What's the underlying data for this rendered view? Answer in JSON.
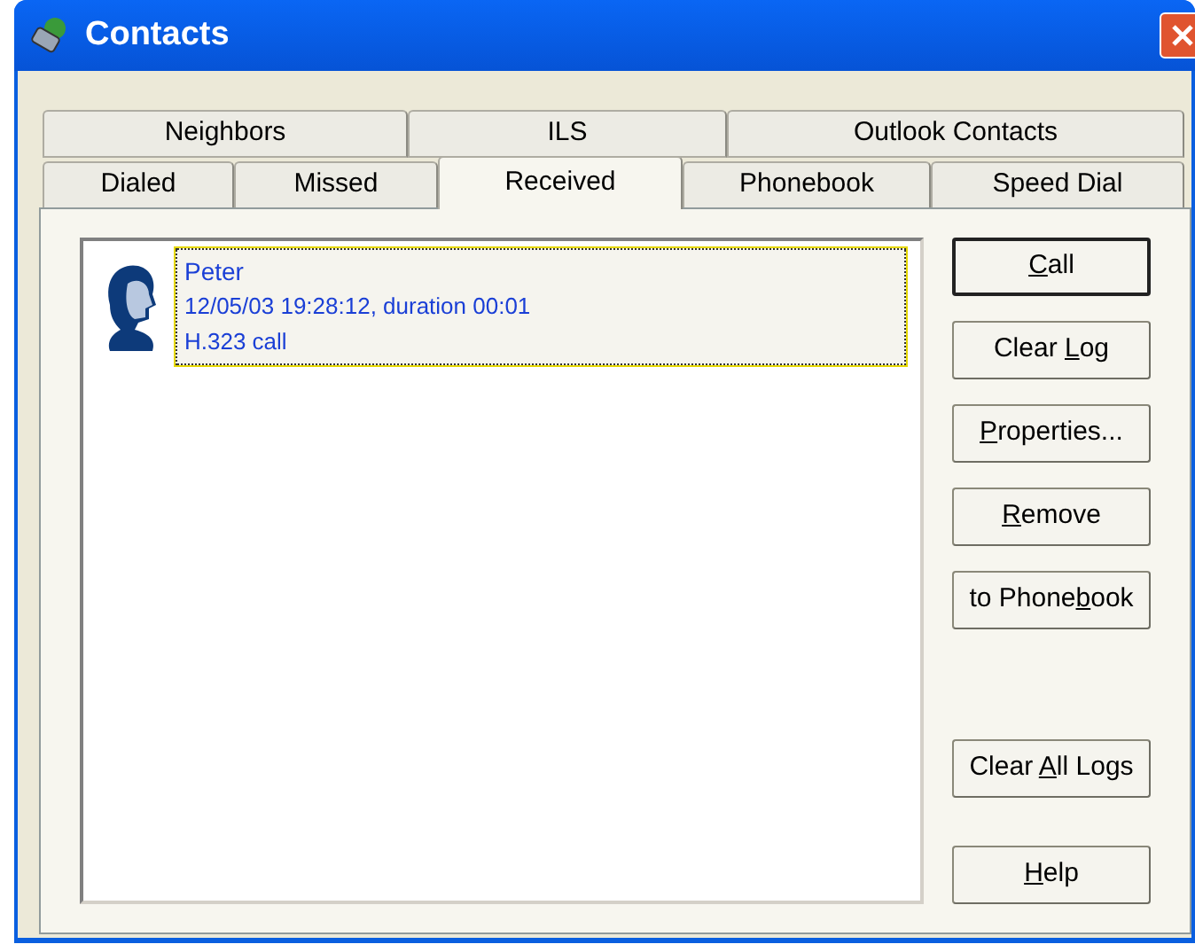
{
  "window": {
    "title": "Contacts"
  },
  "tab_rows": [
    [
      {
        "label": "Neighbors",
        "selected": false
      },
      {
        "label": "ILS",
        "selected": false
      },
      {
        "label": "Outlook Contacts",
        "selected": false
      }
    ],
    [
      {
        "label": "Dialed",
        "selected": false
      },
      {
        "label": "Missed",
        "selected": false
      },
      {
        "label": "Received",
        "selected": true
      },
      {
        "label": "Phonebook",
        "selected": false
      },
      {
        "label": "Speed Dial",
        "selected": false
      }
    ]
  ],
  "log_entries": [
    {
      "name": "Peter",
      "details": "12/05/03 19:28:12, duration 00:01",
      "call_type": "H.323 call",
      "selected": true
    }
  ],
  "button_groups": [
    [
      {
        "key": "C",
        "post": "all",
        "default": true
      },
      {
        "pre": "Clear ",
        "key": "L",
        "post": "og",
        "default": false
      },
      {
        "key": "P",
        "post": "roperties...",
        "default": false
      },
      {
        "key": "R",
        "post": "emove",
        "default": false
      },
      {
        "pre": "to Phone",
        "key": "b",
        "post": "ook",
        "default": false
      }
    ],
    [
      {
        "pre": "Clear ",
        "key": "A",
        "post": "ll Logs",
        "default": false
      },
      {
        "key": "H",
        "post": "elp",
        "default": false
      }
    ]
  ]
}
